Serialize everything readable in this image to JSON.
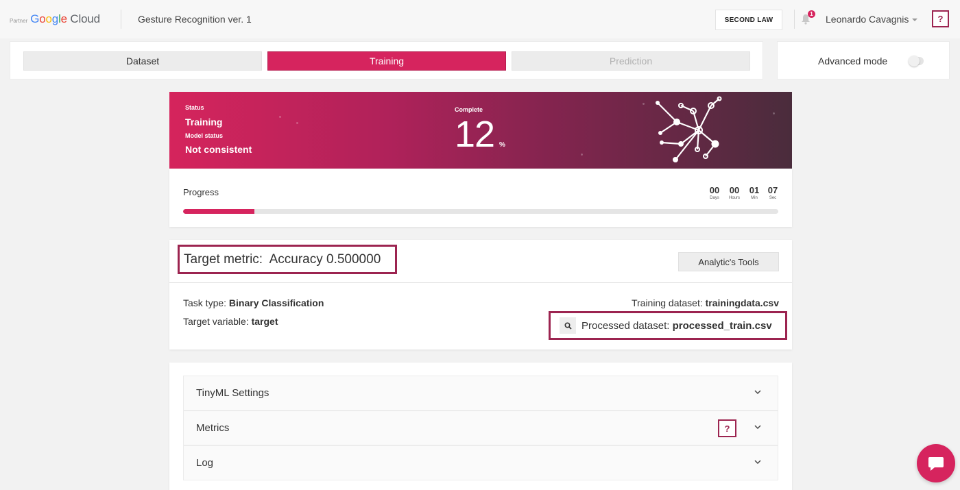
{
  "header": {
    "brand_partner": "Partner",
    "brand_name": "Google Cloud",
    "project_title": "Gesture Recognition ver. 1",
    "org_button": "SECOND LAW",
    "notification_count": "1",
    "user_name": "Leonardo Cavagnis",
    "help_label": "?"
  },
  "tabs": [
    {
      "label": "Dataset",
      "state": "default"
    },
    {
      "label": "Training",
      "state": "active"
    },
    {
      "label": "Prediction",
      "state": "disabled"
    }
  ],
  "advanced_mode": {
    "label": "Advanced mode",
    "enabled": false
  },
  "banner": {
    "status_label": "Status",
    "status_value": "Training",
    "model_status_label": "Model status",
    "model_status_value": "Not consistent",
    "complete_label": "Complete",
    "complete_value": "12",
    "complete_unit": "%"
  },
  "progress": {
    "label": "Progress",
    "fraction": 0.12,
    "timer": [
      {
        "value": "00",
        "unit": "Days"
      },
      {
        "value": "00",
        "unit": "Hours"
      },
      {
        "value": "01",
        "unit": "Min"
      },
      {
        "value": "07",
        "unit": "Sec"
      }
    ]
  },
  "metric": {
    "text": "Target metric:  Accuracy 0.500000",
    "analytics_button": "Analytic's Tools",
    "task_type_label": "Task type: ",
    "task_type_value": "Binary Classification",
    "target_variable_label": "Target variable: ",
    "target_variable_value": "target",
    "training_dataset_label": "Training dataset: ",
    "training_dataset_value": "trainingdata.csv",
    "processed_dataset_label": "Processed dataset: ",
    "processed_dataset_value": "processed_train.csv"
  },
  "accordion": [
    {
      "label": "TinyML Settings",
      "has_help": false
    },
    {
      "label": "Metrics",
      "has_help": true,
      "help_label": "?"
    },
    {
      "label": "Log",
      "has_help": false
    }
  ],
  "colors": {
    "accent": "#d6245e",
    "accent_dark": "#9c2450"
  }
}
